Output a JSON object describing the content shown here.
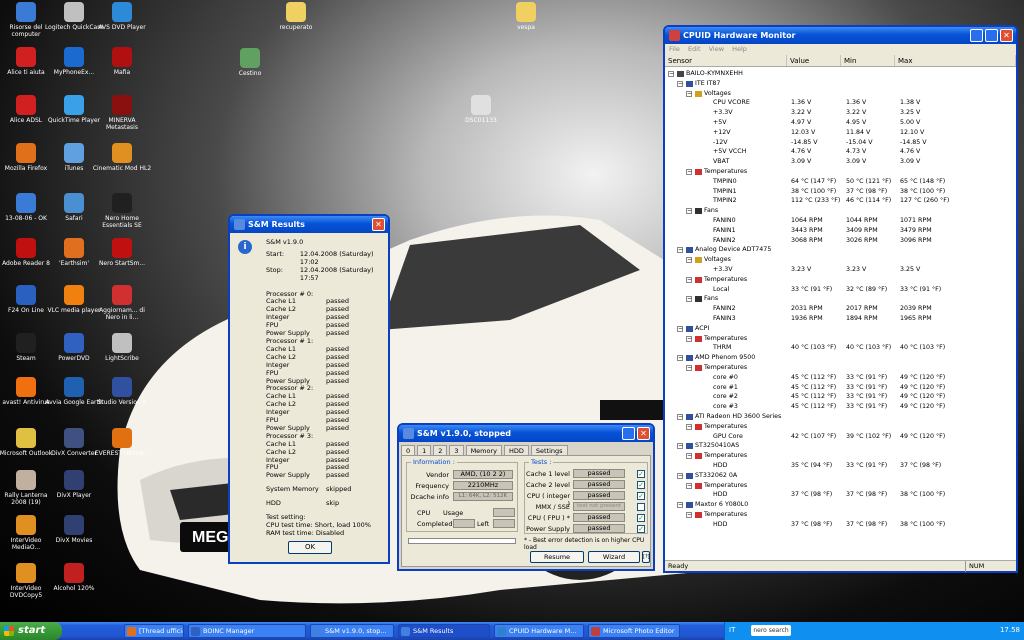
{
  "desktop": {
    "icons": [
      {
        "label": "Risorse del computer",
        "color": "#3a7bd5"
      },
      {
        "label": "Logitech QuickCam",
        "color": "#c0c0c0"
      },
      {
        "label": "AVS DVD Player",
        "color": "#2d8ad8"
      },
      {
        "label": "Alice ti aiuta",
        "color": "#d02020"
      },
      {
        "label": "MyPhoneEx...",
        "color": "#1a6ad0"
      },
      {
        "label": "Mafia",
        "color": "#b01010"
      },
      {
        "label": "Alice ADSL",
        "color": "#d02020"
      },
      {
        "label": "QuickTime Player",
        "color": "#3aa0e8"
      },
      {
        "label": "MINERVA Metastasis",
        "color": "#8a1010"
      },
      {
        "label": "Mozilla Firefox",
        "color": "#e0701a"
      },
      {
        "label": "iTunes",
        "color": "#60a0e0"
      },
      {
        "label": "Cinematic Mod HL2",
        "color": "#e09020"
      },
      {
        "label": "13-08-06 - OK",
        "color": "#3a7bd5"
      },
      {
        "label": "Safari",
        "color": "#4a90d0"
      },
      {
        "label": "Nero Home Essentials SE",
        "color": "#202020"
      },
      {
        "label": "Adobe Reader 8",
        "color": "#c01010"
      },
      {
        "label": "'Earthsim'",
        "color": "#e07020"
      },
      {
        "label": "Nero StartSm...",
        "color": "#c01010"
      },
      {
        "label": "F24 On Line",
        "color": "#2a60c0"
      },
      {
        "label": "VLC media player",
        "color": "#f08010"
      },
      {
        "label": "Aggiornam... di Nero in li...",
        "color": "#d03030"
      },
      {
        "label": "Steam",
        "color": "#202020"
      },
      {
        "label": "PowerDVD",
        "color": "#3060c0"
      },
      {
        "label": "LightScribe",
        "color": "#c0c0c0"
      },
      {
        "label": "avast! Antivirus",
        "color": "#f07010"
      },
      {
        "label": "Avvia Google Earth",
        "color": "#2060b0"
      },
      {
        "label": "Studio Version 9",
        "color": "#3050a0"
      },
      {
        "label": "Microsoft Outlook",
        "color": "#e0c040"
      },
      {
        "label": "DivX Converter",
        "color": "#405080"
      },
      {
        "label": "EVEREST Ultima...",
        "color": "#e07010"
      },
      {
        "label": "Rally Lanterna 2008 (19)",
        "color": "#c0b0a0"
      },
      {
        "label": "DivX Player",
        "color": "#304070"
      },
      {
        "label": "InterVideo MediaO...",
        "color": "#e09020"
      },
      {
        "label": "DivX Movies",
        "color": "#304070"
      },
      {
        "label": "InterVideo DVDCopy5",
        "color": "#e09020"
      },
      {
        "label": "Alcohol 120%",
        "color": "#c02020"
      },
      {
        "label": "recuperato",
        "color": "#f0d060"
      },
      {
        "label": "vespa",
        "color": "#f0d060"
      },
      {
        "label": "Cestino",
        "color": "#60a060"
      },
      {
        "label": "DSC01133",
        "color": "#e0e0e0"
      }
    ]
  },
  "smres": {
    "title": "S&M Results",
    "version": "S&M  v1.9.0",
    "start_label": "Start:",
    "start_value": "12.04.2008 (Saturday)  17:02",
    "stop_label": "Stop:",
    "stop_value": "12.04.2008 (Saturday)  17:57",
    "processors": [
      {
        "header": "Processor # 0:",
        "items": [
          [
            "Cache L1",
            "passed"
          ],
          [
            "Cache L2",
            "passed"
          ],
          [
            "Integer",
            "passed"
          ],
          [
            "FPU",
            "passed"
          ],
          [
            "Power Supply",
            "passed"
          ]
        ]
      },
      {
        "header": "Processor # 1:",
        "items": [
          [
            "Cache L1",
            "passed"
          ],
          [
            "Cache L2",
            "passed"
          ],
          [
            "Integer",
            "passed"
          ],
          [
            "FPU",
            "passed"
          ],
          [
            "Power Supply",
            "passed"
          ]
        ]
      },
      {
        "header": "Processor # 2:",
        "items": [
          [
            "Cache L1",
            "passed"
          ],
          [
            "Cache L2",
            "passed"
          ],
          [
            "Integer",
            "passed"
          ],
          [
            "FPU",
            "passed"
          ],
          [
            "Power Supply",
            "passed"
          ]
        ]
      },
      {
        "header": "Processor # 3:",
        "items": [
          [
            "Cache L1",
            "passed"
          ],
          [
            "Cache L2",
            "passed"
          ],
          [
            "Integer",
            "passed"
          ],
          [
            "FPU",
            "passed"
          ],
          [
            "Power Supply",
            "passed"
          ]
        ]
      }
    ],
    "sys_mem": [
      "System Memory",
      "skipped"
    ],
    "hdd": [
      "HDD",
      "skip"
    ],
    "test_setting": "Test setting:",
    "cpu_setting": "CPU test time: Short, load 100%",
    "ram_setting": "RAM test time: Disabled",
    "ok": "OK"
  },
  "smm": {
    "title": "S&M v1.9.0, stopped",
    "tabs": [
      "0",
      "1",
      "2",
      "3",
      "Memory",
      "HDD",
      "Settings"
    ],
    "info_label": "Information :",
    "vendor_label": "Vendor",
    "vendor": "AMD, (10 2 2)",
    "freq_label": "Frequency",
    "freq": "2210MHz",
    "dcache_label": "Dcache info",
    "dcache": "L1: 64K, L2: 512K",
    "cpu_label": "CPU",
    "usage_label": "Usage",
    "completed_label": "Completed",
    "left_label": "Left",
    "tests_label": "Tests :",
    "tests": [
      [
        "Cache 1 level",
        "passed"
      ],
      [
        "Cache 2 level",
        "passed"
      ],
      [
        "CPU ( integer )",
        "passed"
      ],
      [
        "MMX / SSE",
        "test not present"
      ],
      [
        "CPU ( FPU ) *",
        "passed"
      ],
      [
        "Power Supply",
        "passed"
      ]
    ],
    "note": "* - Best error detection is on higher CPU load",
    "resume": "Resume",
    "wizard": "Wizard",
    "q": "[?]"
  },
  "hwm": {
    "title": "CPUID Hardware Monitor",
    "menu": "File Edit View Help",
    "cols": [
      "Sensor",
      "Value",
      "Min",
      "Max"
    ],
    "status": "Ready",
    "num": "NUM",
    "rows": [
      {
        "i": 0,
        "n": "BAILO-KYMNXEHH",
        "v": "",
        "mi": "",
        "ma": ""
      },
      {
        "i": 1,
        "n": "ITE IT87",
        "v": "",
        "mi": "",
        "ma": ""
      },
      {
        "i": 2,
        "n": "Voltages",
        "v": "",
        "mi": "",
        "ma": ""
      },
      {
        "i": 3,
        "n": "CPU VCORE",
        "v": "1.36 V",
        "mi": "1.36 V",
        "ma": "1.38 V"
      },
      {
        "i": 3,
        "n": "+3.3V",
        "v": "3.22 V",
        "mi": "3.22 V",
        "ma": "3.25 V"
      },
      {
        "i": 3,
        "n": "+5V",
        "v": "4.97 V",
        "mi": "4.95 V",
        "ma": "5.00 V"
      },
      {
        "i": 3,
        "n": "+12V",
        "v": "12.03 V",
        "mi": "11.84 V",
        "ma": "12.10 V"
      },
      {
        "i": 3,
        "n": "-12V",
        "v": "-14.85 V",
        "mi": "-15.04 V",
        "ma": "-14.85 V"
      },
      {
        "i": 3,
        "n": "+5V VCCH",
        "v": "4.76 V",
        "mi": "4.73 V",
        "ma": "4.76 V"
      },
      {
        "i": 3,
        "n": "VBAT",
        "v": "3.09 V",
        "mi": "3.09 V",
        "ma": "3.09 V"
      },
      {
        "i": 2,
        "n": "Temperatures",
        "v": "",
        "mi": "",
        "ma": ""
      },
      {
        "i": 3,
        "n": "TMPIN0",
        "v": "64 °C  (147 °F)",
        "mi": "50 °C  (121 °F)",
        "ma": "65 °C  (148 °F)"
      },
      {
        "i": 3,
        "n": "TMPIN1",
        "v": "38 °C  (100 °F)",
        "mi": "37 °C  (98 °F)",
        "ma": "38 °C  (100 °F)"
      },
      {
        "i": 3,
        "n": "TMPIN2",
        "v": "112 °C  (233 °F)",
        "mi": "46 °C  (114 °F)",
        "ma": "127 °C  (260 °F)"
      },
      {
        "i": 2,
        "n": "Fans",
        "v": "",
        "mi": "",
        "ma": ""
      },
      {
        "i": 3,
        "n": "FANIN0",
        "v": "1064 RPM",
        "mi": "1044 RPM",
        "ma": "1071 RPM"
      },
      {
        "i": 3,
        "n": "FANIN1",
        "v": "3443 RPM",
        "mi": "3409 RPM",
        "ma": "3479 RPM"
      },
      {
        "i": 3,
        "n": "FANIN2",
        "v": "3068 RPM",
        "mi": "3026 RPM",
        "ma": "3096 RPM"
      },
      {
        "i": 1,
        "n": "Analog Device ADT7475",
        "v": "",
        "mi": "",
        "ma": ""
      },
      {
        "i": 2,
        "n": "Voltages",
        "v": "",
        "mi": "",
        "ma": ""
      },
      {
        "i": 3,
        "n": "+3.3V",
        "v": "3.23 V",
        "mi": "3.23 V",
        "ma": "3.25 V"
      },
      {
        "i": 2,
        "n": "Temperatures",
        "v": "",
        "mi": "",
        "ma": ""
      },
      {
        "i": 3,
        "n": "Local",
        "v": "33 °C  (91 °F)",
        "mi": "32 °C  (89 °F)",
        "ma": "33 °C  (91 °F)"
      },
      {
        "i": 2,
        "n": "Fans",
        "v": "",
        "mi": "",
        "ma": ""
      },
      {
        "i": 3,
        "n": "FANIN2",
        "v": "2031 RPM",
        "mi": "2017 RPM",
        "ma": "2039 RPM"
      },
      {
        "i": 3,
        "n": "FANIN3",
        "v": "1936 RPM",
        "mi": "1894 RPM",
        "ma": "1965 RPM"
      },
      {
        "i": 1,
        "n": "ACPI",
        "v": "",
        "mi": "",
        "ma": ""
      },
      {
        "i": 2,
        "n": "Temperatures",
        "v": "",
        "mi": "",
        "ma": ""
      },
      {
        "i": 3,
        "n": "THRM",
        "v": "40 °C  (103 °F)",
        "mi": "40 °C  (103 °F)",
        "ma": "40 °C  (103 °F)"
      },
      {
        "i": 1,
        "n": "AMD Phenom 9500",
        "v": "",
        "mi": "",
        "ma": ""
      },
      {
        "i": 2,
        "n": "Temperatures",
        "v": "",
        "mi": "",
        "ma": ""
      },
      {
        "i": 3,
        "n": "core #0",
        "v": "45 °C  (112 °F)",
        "mi": "33 °C  (91 °F)",
        "ma": "49 °C  (120 °F)"
      },
      {
        "i": 3,
        "n": "core #1",
        "v": "45 °C  (112 °F)",
        "mi": "33 °C  (91 °F)",
        "ma": "49 °C  (120 °F)"
      },
      {
        "i": 3,
        "n": "core #2",
        "v": "45 °C  (112 °F)",
        "mi": "33 °C  (91 °F)",
        "ma": "49 °C  (120 °F)"
      },
      {
        "i": 3,
        "n": "core #3",
        "v": "45 °C  (112 °F)",
        "mi": "33 °C  (91 °F)",
        "ma": "49 °C  (120 °F)"
      },
      {
        "i": 1,
        "n": "ATI Radeon HD 3600 Series",
        "v": "",
        "mi": "",
        "ma": ""
      },
      {
        "i": 2,
        "n": "Temperatures",
        "v": "",
        "mi": "",
        "ma": ""
      },
      {
        "i": 3,
        "n": "GPU Core",
        "v": "42 °C  (107 °F)",
        "mi": "39 °C  (102 °F)",
        "ma": "49 °C  (120 °F)"
      },
      {
        "i": 1,
        "n": "ST3250410AS",
        "v": "",
        "mi": "",
        "ma": ""
      },
      {
        "i": 2,
        "n": "Temperatures",
        "v": "",
        "mi": "",
        "ma": ""
      },
      {
        "i": 3,
        "n": "HDD",
        "v": "35 °C  (94 °F)",
        "mi": "33 °C  (91 °F)",
        "ma": "37 °C  (98 °F)"
      },
      {
        "i": 1,
        "n": "ST332062 0A",
        "v": "",
        "mi": "",
        "ma": ""
      },
      {
        "i": 2,
        "n": "Temperatures",
        "v": "",
        "mi": "",
        "ma": ""
      },
      {
        "i": 3,
        "n": "HDD",
        "v": "37 °C  (98 °F)",
        "mi": "37 °C  (98 °F)",
        "ma": "38 °C  (100 °F)"
      },
      {
        "i": 1,
        "n": "Maxtor 6 Y080L0",
        "v": "",
        "mi": "",
        "ma": ""
      },
      {
        "i": 2,
        "n": "Temperatures",
        "v": "",
        "mi": "",
        "ma": ""
      },
      {
        "i": 3,
        "n": "HDD",
        "v": "37 °C  (98 °F)",
        "mi": "37 °C  (98 °F)",
        "ma": "38 °C  (100 °F)"
      }
    ]
  },
  "car_logo": "MEGANE",
  "taskbar": {
    "start": "start",
    "items": [
      {
        "label": "[Thread ufficiale] A...",
        "color": "#e07020"
      },
      {
        "label": "BOINC Manager",
        "color": "#3060c0"
      },
      {
        "label": "S&M v1.9.0, stop...",
        "color": "#4080e0"
      },
      {
        "label": "S&M Results",
        "color": "#4080e0"
      },
      {
        "label": "CPUID Hardware M...",
        "color": "#3080d0"
      },
      {
        "label": "Microsoft Photo Editor",
        "color": "#c04040"
      }
    ],
    "lang": "IT",
    "nero": "nero search",
    "clock": "17.58"
  }
}
